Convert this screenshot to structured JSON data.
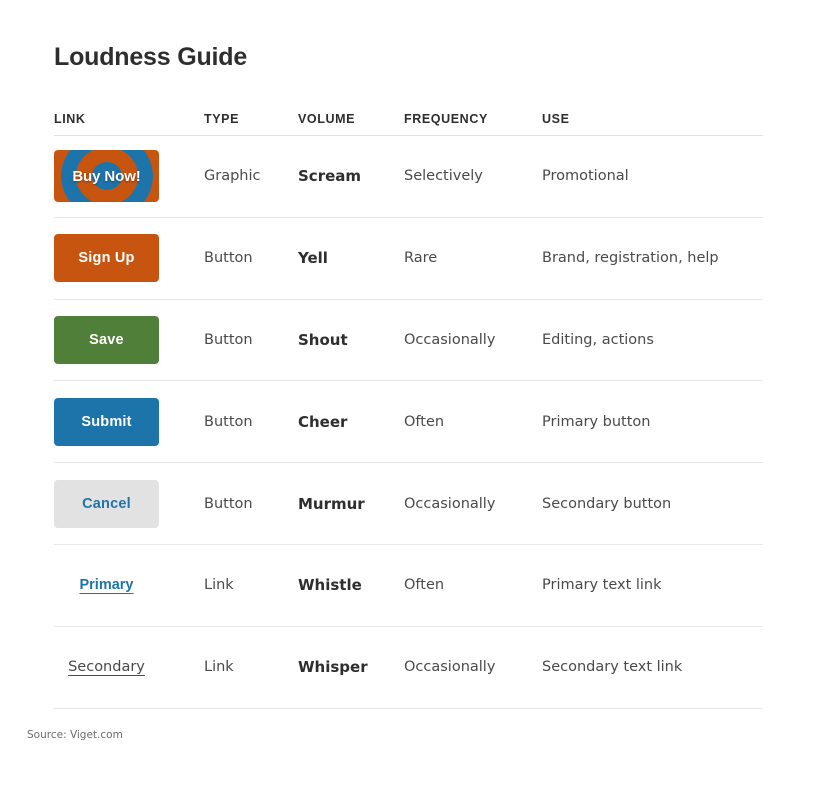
{
  "header": {
    "title": "Loudness Guide"
  },
  "table": {
    "columns": [
      "LINK",
      "TYPE",
      "VOLUME",
      "FREQUENCY",
      "USE"
    ],
    "rows": [
      {
        "sample_kind": "graphic-target",
        "sample_label": "Buy Now!",
        "type": "Graphic",
        "volume": "Scream",
        "frequency": "Selectively",
        "use": "Promotional",
        "colors": {
          "base": "#c8550f",
          "accent": "#1d74ab",
          "text": "#ffffff"
        }
      },
      {
        "sample_kind": "button-orange",
        "sample_label": "Sign Up",
        "type": "Button",
        "volume": "Yell",
        "frequency": "Rare",
        "use": "Brand, registration, help",
        "colors": {
          "base": "#c8550f",
          "text": "#ffffff"
        }
      },
      {
        "sample_kind": "button-green",
        "sample_label": "Save",
        "type": "Button",
        "volume": "Shout",
        "frequency": "Occasionally",
        "use": "Editing, actions",
        "colors": {
          "base": "#507f39",
          "text": "#ffffff"
        }
      },
      {
        "sample_kind": "button-blue",
        "sample_label": "Submit",
        "type": "Button",
        "volume": "Cheer",
        "frequency": "Often",
        "use": "Primary button",
        "colors": {
          "base": "#1d74ab",
          "text": "#ffffff"
        }
      },
      {
        "sample_kind": "button-gray",
        "sample_label": "Cancel",
        "type": "Button",
        "volume": "Murmur",
        "frequency": "Occasionally",
        "use": "Secondary button",
        "colors": {
          "base": "#e2e2e2",
          "text": "#1d74ab"
        }
      },
      {
        "sample_kind": "link-primary",
        "sample_label": "Primary",
        "type": "Link",
        "volume": "Whistle",
        "frequency": "Often",
        "use": "Primary text link",
        "colors": {
          "text": "#1d74ab"
        }
      },
      {
        "sample_kind": "link-secondary",
        "sample_label": "Secondary",
        "type": "Link",
        "volume": "Whisper",
        "frequency": "Occasionally",
        "use": "Secondary text link",
        "colors": {
          "text": "#4a4a4a"
        }
      }
    ]
  },
  "footer": {
    "source": "Source: Viget.com"
  }
}
